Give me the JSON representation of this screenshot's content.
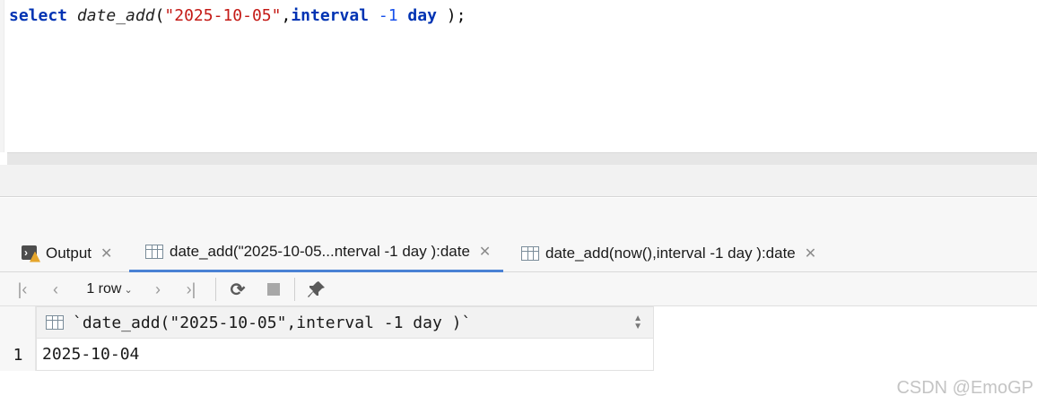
{
  "editor": {
    "tokens": {
      "kw_select": "select",
      "fn_name": "date_add",
      "open": "(",
      "str_date": "\"2025-10-05\"",
      "comma": ",",
      "kw_interval": "interval",
      "num_value": "-1",
      "kw_day": "day",
      "close": ");"
    }
  },
  "tabs": [
    {
      "label": "Output",
      "icon": "output-console-icon",
      "close": "✕",
      "active": false
    },
    {
      "label": "date_add(\"2025-10-05...nterval -1 day ):date",
      "icon": "table-grid-icon",
      "close": "✕",
      "active": true
    },
    {
      "label": "date_add(now(),interval -1 day ):date",
      "icon": "table-grid-icon",
      "close": "✕",
      "active": false
    }
  ],
  "toolbar": {
    "first": "|‹",
    "prev": "‹",
    "rows_label": "1 row",
    "next": "›",
    "last": "›|",
    "refresh": "⟳",
    "pin": "📌"
  },
  "result": {
    "columns": [
      "`date_add(\"2025-10-05\",interval -1 day )`"
    ],
    "rows": [
      {
        "num": "1",
        "cells": [
          "2025-10-04"
        ]
      }
    ]
  },
  "watermark": "CSDN @EmoGP",
  "colors": {
    "keyword": "#0033b3",
    "string": "#c41a16",
    "number": "#1750eb",
    "active_tab_underline": "#4a82d4"
  }
}
